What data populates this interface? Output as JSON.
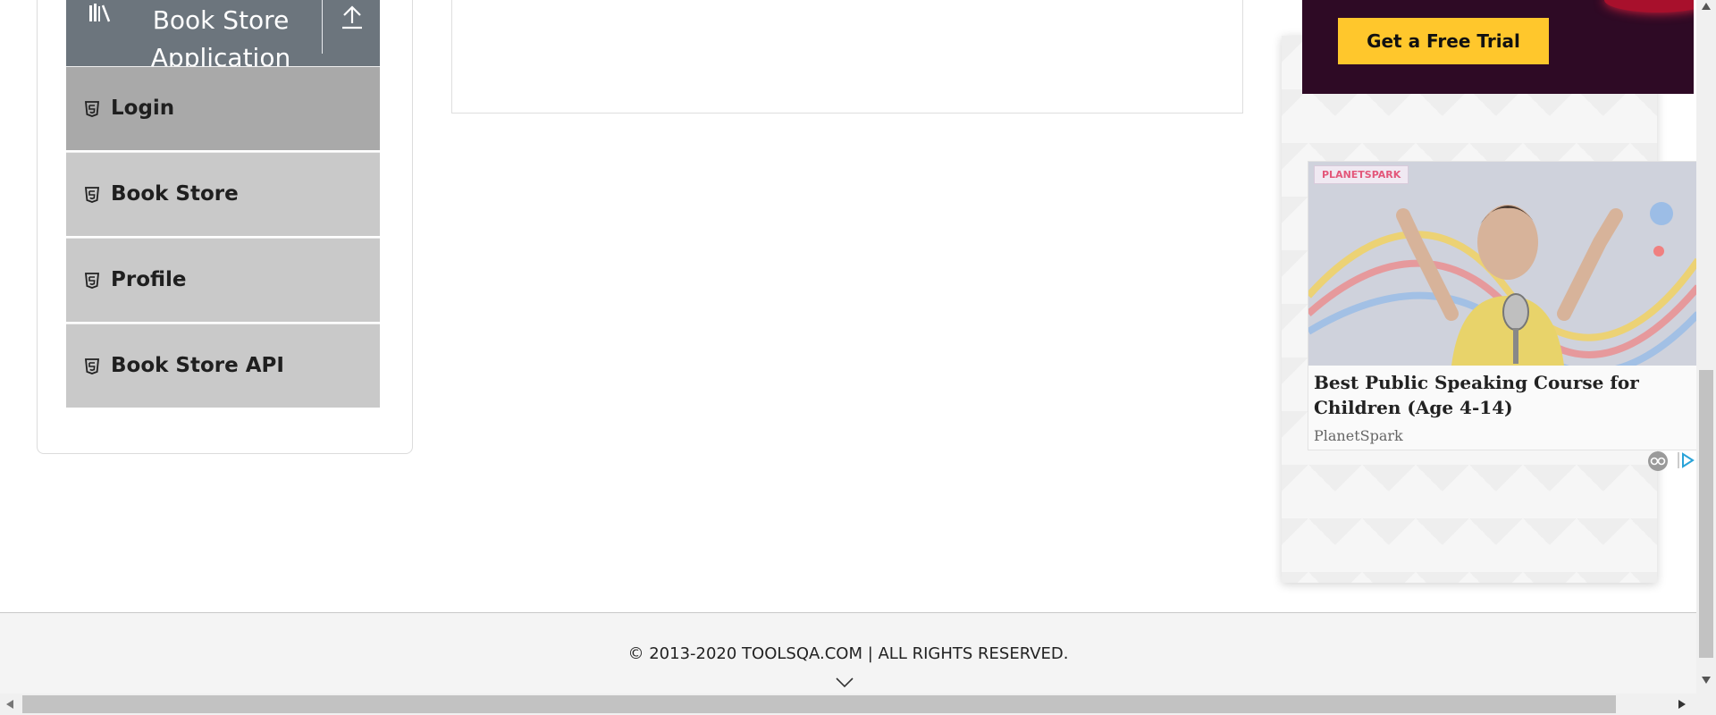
{
  "sidebar": {
    "group_title": "Book Store Application",
    "group_icon": "library-books-icon",
    "collapse_icon": "upload-arrow-icon",
    "items": [
      {
        "label": "Login",
        "icon": "html5-icon",
        "active": true
      },
      {
        "label": "Book Store",
        "icon": "html5-icon",
        "active": false
      },
      {
        "label": "Profile",
        "icon": "html5-icon",
        "active": false
      },
      {
        "label": "Book Store API",
        "icon": "html5-icon",
        "active": false
      }
    ]
  },
  "ads": {
    "banner_button": "Get a Free Trial",
    "card_logo": "PLANETSPARK",
    "card_headline": "Best Public Speaking Course for Children (Age 4-14)",
    "card_source": "PlanetSpark"
  },
  "footer": {
    "copyright": "© 2013-2020 TOOLSQA.COM | ALL RIGHTS RESERVED."
  },
  "colors": {
    "header_bg": "#6c757d",
    "menu_bg": "#c9c9c9",
    "menu_active_bg": "#a9a9a9",
    "cta_yellow": "#ffc72c",
    "banner_bg": "#2e0a25"
  }
}
